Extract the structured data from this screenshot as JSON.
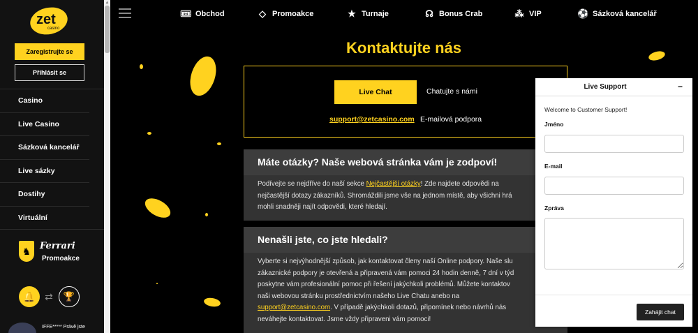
{
  "brand": {
    "logo_text": "zet",
    "logo_subtext": "casino",
    "accent_color": "#ffd21f"
  },
  "sidebar": {
    "register_label": "Zaregistrujte se",
    "login_label": "Přihlásit se",
    "items": [
      {
        "label": "Casino"
      },
      {
        "label": "Live Casino"
      },
      {
        "label": "Sázková kancelář"
      },
      {
        "label": "Live sázky"
      },
      {
        "label": "Dostihy"
      },
      {
        "label": "Virtuální"
      }
    ],
    "ferrari_word": "Ferrari",
    "ferrari_promo": "Promoakce",
    "ticker_text": "IFFE***** Právě jste"
  },
  "topnav": {
    "items": [
      {
        "label": "Obchod",
        "icon": "ticket-icon"
      },
      {
        "label": "Promoakce",
        "icon": "diamond-icon"
      },
      {
        "label": "Turnaje",
        "icon": "star-icon"
      },
      {
        "label": "Bonus Crab",
        "icon": "claw-icon"
      },
      {
        "label": "VIP",
        "icon": "stars-icon"
      },
      {
        "label": "Sázková kancelář",
        "icon": "soccer-ball-icon"
      }
    ]
  },
  "main": {
    "title": "Kontaktujte nás",
    "live_chat_button": "Live Chat",
    "live_chat_label": "Chatujte s námi",
    "email": "support@zetcasino.com",
    "email_label": "E-mailová podpora",
    "card1": {
      "title": "Máte otázky? Naše webová stránka vám je zodpoví!",
      "line1_pre": "Podívejte se nejdříve do naší sekce ",
      "line1_link": "Nejčastější otázky",
      "line1_post": "! Zde najdete odpovědi na",
      "line2": "nejčastější dotazy zákazníků. Shromáždili jsme vše na jednom místě, aby všichni hrá",
      "line3": "mohli snadněji najít odpovědi, které hledají."
    },
    "card2": {
      "title": "Nenašli jste, co jste hledali?",
      "line1": "Vyberte si nejvýhodnější způsob, jak kontaktovat členy naší Online podpory. Naše slu",
      "line2": "zákaznické podpory je otevřená a připravená vám pomoci 24 hodin denně, 7 dní v týd",
      "line3": "poskytne vám profesionální pomoc při řešení jakýchkoli problémů. Můžete kontaktov",
      "line4": "naši webovou stránku prostřednictvím našeho Live Chatu anebo na",
      "line5_link": "support@zetcasino.com",
      "line5_post": ". V případě jakýchkoli dotazů, připomínek nebo návrhů nás",
      "line6": "neváhejte kontaktovat. Jsme vždy připraveni vám pomoci!"
    }
  },
  "support": {
    "title": "Live Support",
    "minimize": "−",
    "welcome": "Welcome to Customer Support!",
    "name_label": "Jméno",
    "name_value": "",
    "email_label": "E-mail",
    "email_value": "",
    "message_label": "Zpráva",
    "message_value": "",
    "start_button": "Zahájit chat"
  }
}
